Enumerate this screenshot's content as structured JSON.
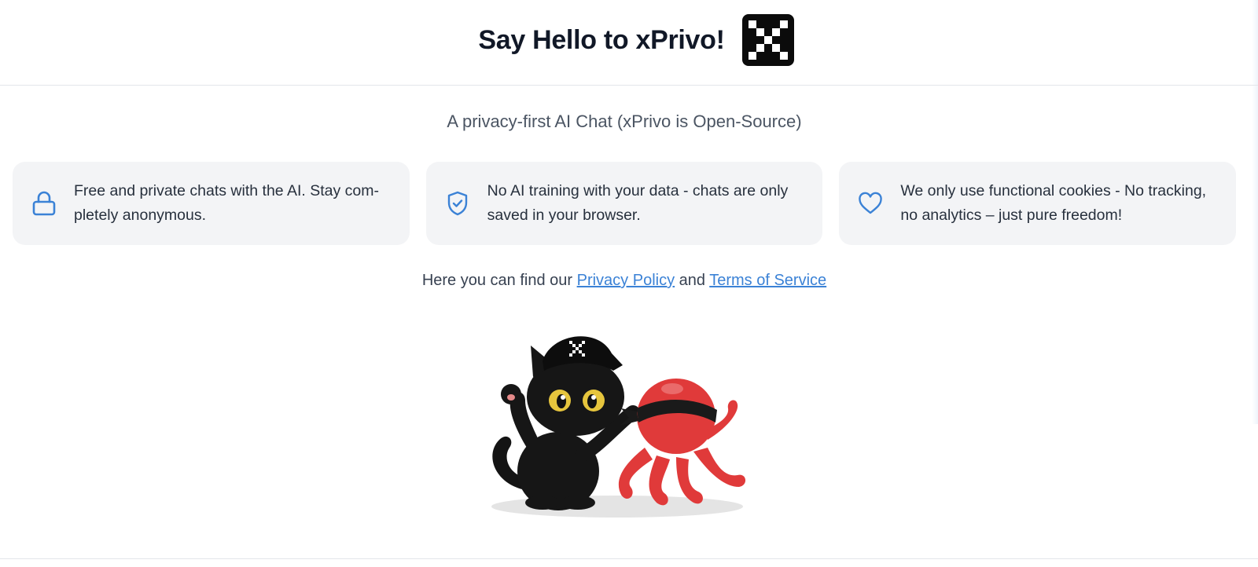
{
  "header": {
    "title": "Say Hello to xPrivo!",
    "logo_icon": "xprivo-logo-icon"
  },
  "subtitle": "A privacy-first AI Chat (xPrivo is Open-Source)",
  "features": [
    {
      "icon": "lock-icon",
      "text": "Free and private chats with the AI. Stay com-pletely anonymous."
    },
    {
      "icon": "shield-check-icon",
      "text": "No AI training with your data - chats are only saved in your browser."
    },
    {
      "icon": "heart-icon",
      "text": "We only use functional cookies - No tracking, no analytics – just pure freedom!"
    }
  ],
  "links": {
    "prefix": "Here you can find our ",
    "privacy_label": "Privacy Policy",
    "middle": " and ",
    "terms_label": "Terms of Service"
  },
  "mascot": {
    "description_icon": "cat-and-octopus-mascot-illustration"
  },
  "colors": {
    "accent": "#3b82d6",
    "card_bg": "#f3f4f6",
    "text": "#1f2937",
    "octopus": "#e03a3a"
  }
}
